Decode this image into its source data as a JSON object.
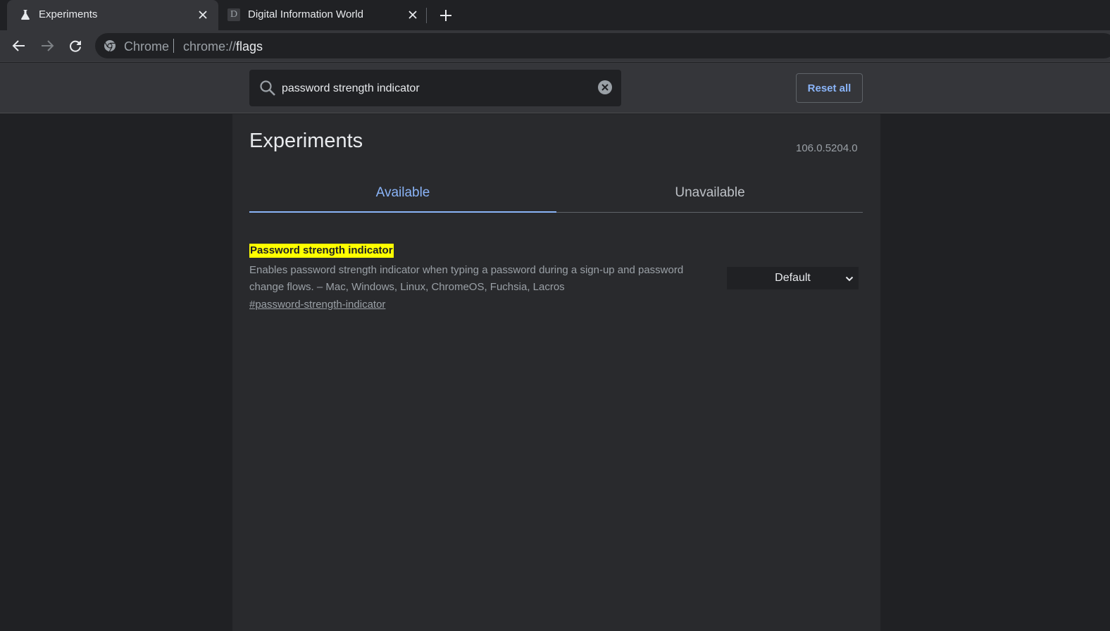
{
  "browser": {
    "tabs": [
      {
        "title": "Experiments",
        "icon": "flask-icon",
        "active": true
      },
      {
        "title": "Digital Information World",
        "icon": "d-favicon",
        "favicon_letter": "D",
        "active": false
      }
    ],
    "toolbar": {
      "origin_chip": "Chrome",
      "url_scheme": "chrome://",
      "url_host": "flags"
    }
  },
  "header": {
    "search": {
      "value": "password strength indicator"
    },
    "reset_label": "Reset all"
  },
  "main": {
    "title": "Experiments",
    "version": "106.0.5204.0",
    "tabs": [
      {
        "label": "Available",
        "selected": true
      },
      {
        "label": "Unavailable",
        "selected": false
      }
    ],
    "experiments": [
      {
        "name": "Password strength indicator",
        "description": "Enables password strength indicator when typing a password during a sign-up and password change flows. – Mac, Windows, Linux, ChromeOS, Fuchsia, Lacros",
        "link": "#password-strength-indicator",
        "selected_option": "Default"
      }
    ]
  },
  "colors": {
    "accent": "#8ab4f8",
    "highlight": "#ffff00",
    "background": "#202124",
    "surface": "#292a2d"
  }
}
